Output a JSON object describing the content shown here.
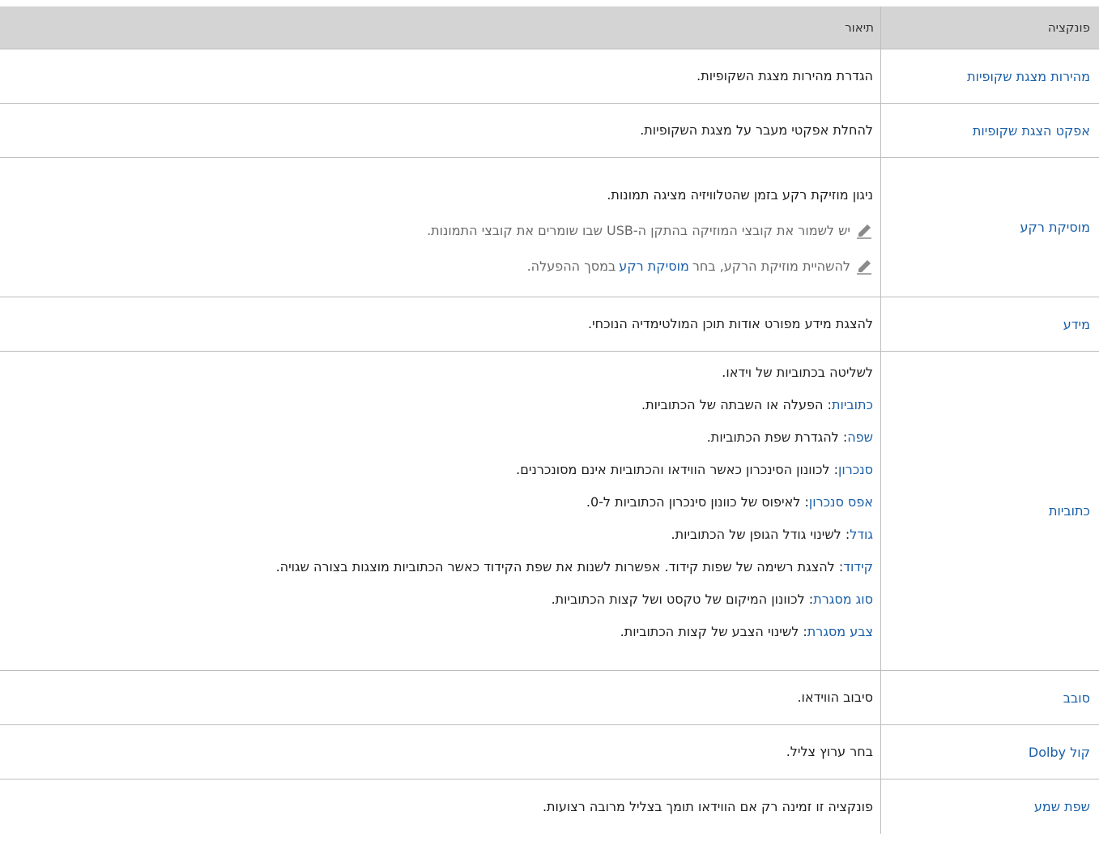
{
  "table": {
    "header": {
      "function": "פונקציה",
      "description": "תיאור"
    },
    "rows": [
      {
        "function": "מהירות מצגת שקופיות",
        "description": "הגדרת מהירות מצגת השקופיות."
      },
      {
        "function": "אפקט הצגת שקופיות",
        "description": "להחלת אפקטי מעבר על מצגת השקופיות."
      },
      {
        "function": "מוסיקת רקע",
        "description": "ניגון מוזיקת רקע בזמן שהטלוויזיה מציגה תמונות.",
        "notes": [
          {
            "text": "יש לשמור את קובצי המוזיקה בהתקן ה-USB שבו שומרים את קובצי התמונות."
          },
          {
            "before": "להשהיית מוזיקת הרקע, בחר ",
            "keyword": "מוסיקת רקע",
            "after": " במסך ההפעלה."
          }
        ]
      },
      {
        "function": "מידע",
        "description": "להצגת מידע מפורט אודות תוכן המולטימדיה הנוכחי."
      },
      {
        "function": "כתוביות",
        "description": "לשליטה בכתוביות של וידאו.",
        "items": [
          {
            "keyword": "כתוביות",
            "text": ": הפעלה או השבתה של הכתוביות."
          },
          {
            "keyword": "שפה",
            "text": ": להגדרת שפת הכתוביות."
          },
          {
            "keyword": "סנכרון",
            "text": ": לכוונון הסינכרון כאשר הווידאו והכתוביות אינם מסונכרנים."
          },
          {
            "keyword": "אפס סנכרון",
            "text": ": לאיפוס של כוונון סינכרון הכתוביות ל-0."
          },
          {
            "keyword": "גודל",
            "text": ": לשינוי גודל הגופן של הכתוביות."
          },
          {
            "keyword": "קידוד",
            "text": ": להצגת רשימה של שפות קידוד. אפשרות לשנות את שפת הקידוד כאשר הכתוביות מוצגות בצורה שגויה."
          },
          {
            "keyword": "סוג מסגרת",
            "text": ": לכוונון המיקום של טקסט ושל קצות הכתוביות."
          },
          {
            "keyword": "צבע מסגרת",
            "text": ": לשינוי הצבע של קצות הכתוביות."
          }
        ]
      },
      {
        "function": "סובב",
        "description": "סיבוב הווידאו."
      },
      {
        "function": "קול Dolby",
        "description": "בחר ערוץ צליל."
      },
      {
        "function": "שפת שמע",
        "description": "פונקציה זו זמינה רק אם הווידאו תומך בצליל מרובה רצועות."
      }
    ]
  },
  "icons": {
    "note": "pencil-icon"
  },
  "colors": {
    "header_bg": "#d4d4d4",
    "keyword": "#1a5fa8",
    "note_text": "#6a6a6a",
    "border": "#bdbdbd"
  }
}
